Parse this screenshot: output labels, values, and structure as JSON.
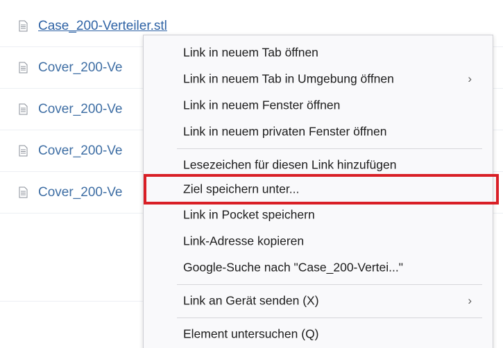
{
  "files": [
    {
      "name": "Case_200-Verteiler.stl"
    },
    {
      "name": "Cover_200-Ve"
    },
    {
      "name": "Cover_200-Ve"
    },
    {
      "name": "Cover_200-Ve"
    },
    {
      "name": "Cover_200-Ve"
    }
  ],
  "context_menu": {
    "items": [
      {
        "label": "Link in neuem Tab öffnen"
      },
      {
        "label": "Link in neuem Tab in Umgebung öffnen",
        "submenu_arrow": "›"
      },
      {
        "label": "Link in neuem Fenster öffnen"
      },
      {
        "label": "Link in neuem privaten Fenster öffnen"
      },
      {
        "label": "Lesezeichen für diesen Link hinzufügen"
      },
      {
        "label": "Ziel speichern unter..."
      },
      {
        "label": "Link in Pocket speichern"
      },
      {
        "label": "Link-Adresse kopieren"
      },
      {
        "label": "Google-Suche nach \"Case_200-Vertei...\""
      },
      {
        "label": "Link an Gerät senden (X)",
        "submenu_arrow": "›"
      },
      {
        "label": "Element untersuchen (Q)"
      }
    ],
    "highlighted_item": "Ziel speichern unter...",
    "highlight_color": "#d91f26"
  },
  "colors": {
    "link": "#3e6ea4",
    "menu_background": "#f9f9fb"
  }
}
